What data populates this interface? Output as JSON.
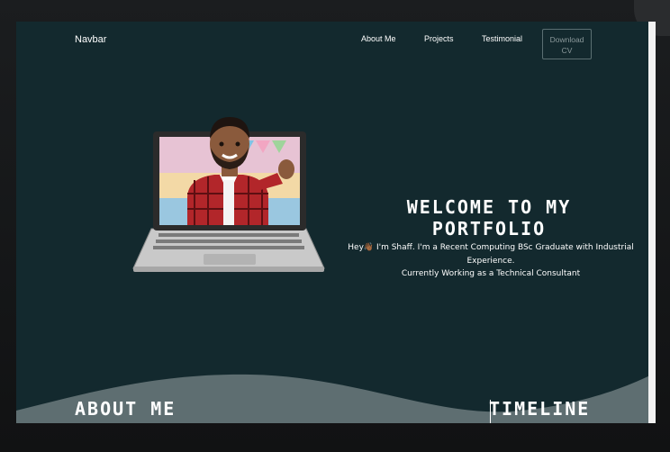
{
  "navbar": {
    "brand": "Navbar",
    "links": [
      "About Me",
      "Projects",
      "Testimonial"
    ],
    "download_label_line1": "Download",
    "download_label_line2": "CV"
  },
  "hero": {
    "title": "Welcome to my Portfolio",
    "subtitle_line1": "Hey👋🏾 I'm Shaff. I'm a Recent Computing BSc Graduate with Industrial Experience.",
    "subtitle_line2": "Currently Working as a Technical Consultant"
  },
  "sections": {
    "about": "About me",
    "timeline": "Timeline"
  },
  "colors": {
    "background": "#13292e",
    "wave": "#5e6e71",
    "text": "#ffffff",
    "button_border": "#5b6f72"
  },
  "icons": {
    "hero_image": "bitmoji-waving-laptop"
  }
}
